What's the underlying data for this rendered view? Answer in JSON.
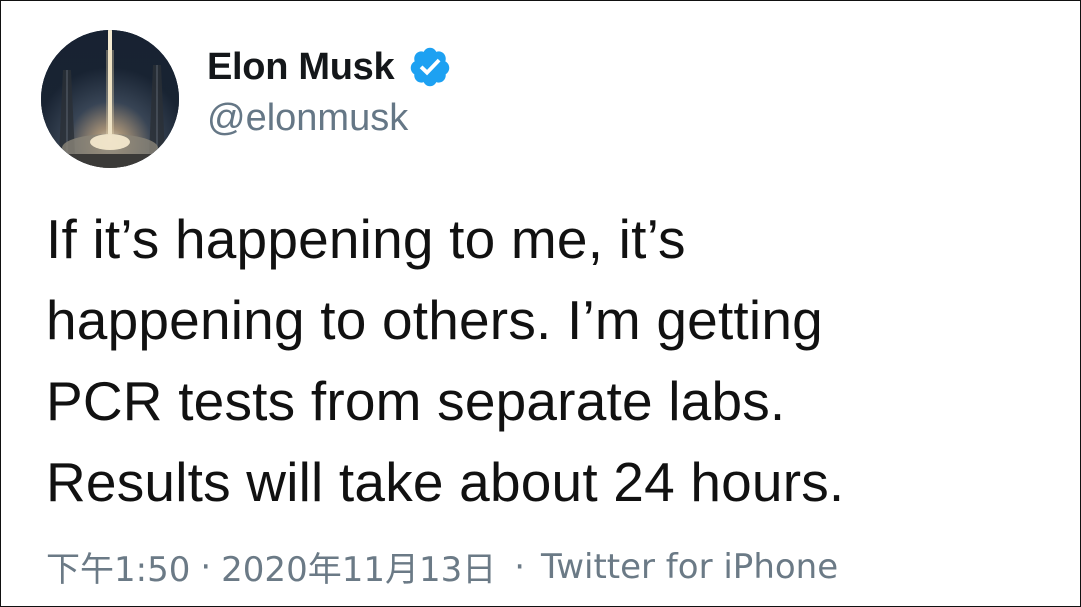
{
  "author": {
    "display_name": "Elon Musk",
    "handle": "@elonmusk",
    "verified": true
  },
  "tweet": {
    "text_lines": [
      "If it’s happening to me, it’s",
      "happening to others. I’m getting",
      "PCR tests from separate labs.",
      "Results will take about 24 hours."
    ]
  },
  "meta": {
    "time": "下午1:50",
    "separator": "·",
    "date": "2020年11月13日",
    "source": "Twitter for iPhone"
  },
  "colors": {
    "verified_badge": "#1da1f2",
    "handle": "#657786",
    "meta": "#6b7a86"
  },
  "icons": {
    "verified": "verified-badge-icon"
  }
}
